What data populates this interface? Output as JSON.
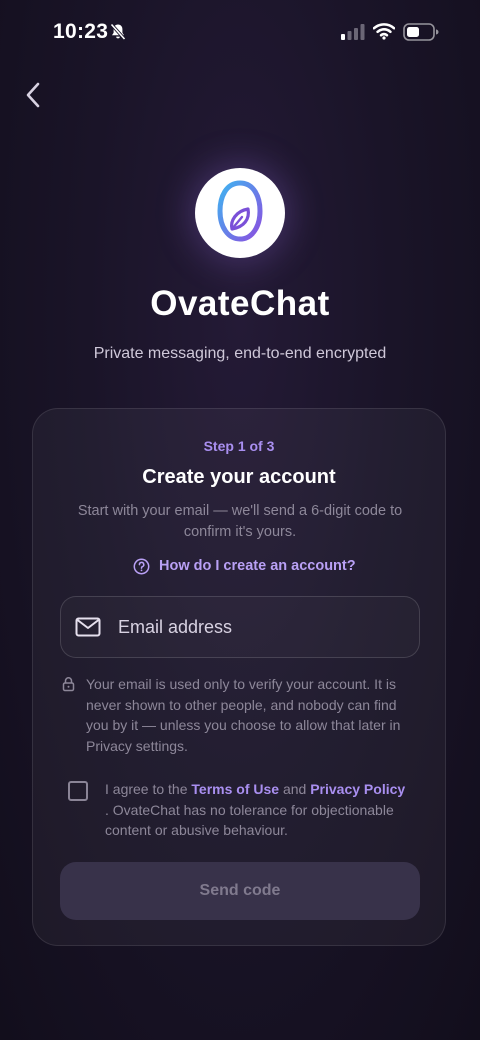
{
  "status_bar": {
    "time": "10:23",
    "icons": [
      "bell-slash-icon",
      "signal-icon",
      "wifi-icon",
      "battery-icon"
    ]
  },
  "header": {
    "back_icon": "chevron-left-icon"
  },
  "app": {
    "name": "OvateChat",
    "tagline": "Private messaging, end-to-end encrypted",
    "logo_icon": "ovatechat-logo-icon"
  },
  "card": {
    "step": "Step 1 of 3",
    "title": "Create your account",
    "subtitle": "Start with your email — we'll send a 6-digit code to confirm it's yours.",
    "help_link": "How do I create an account?",
    "email_placeholder": "Email address",
    "email_value": "",
    "privacy_note": "Your email is used only to verify your account. It is never shown to other people, and nobody can find you by it — unless you choose to allow that later in Privacy settings.",
    "agree_prefix": "I agree to the ",
    "terms_label": "Terms of Use",
    "agree_and": " and ",
    "privacy_label": "Privacy Policy",
    "agree_suffix": ". OvateChat has no tolerance for objectionable content or abusive behaviour.",
    "agree_checked": false,
    "send_button": "Send code"
  },
  "colors": {
    "background": "#1a1428",
    "accent": "#a98ff0",
    "button_disabled": "#38324a",
    "button_text_disabled": "#807a8e",
    "logo_gradient_start": "#3fb4f0",
    "logo_gradient_end": "#8a4fe0"
  }
}
